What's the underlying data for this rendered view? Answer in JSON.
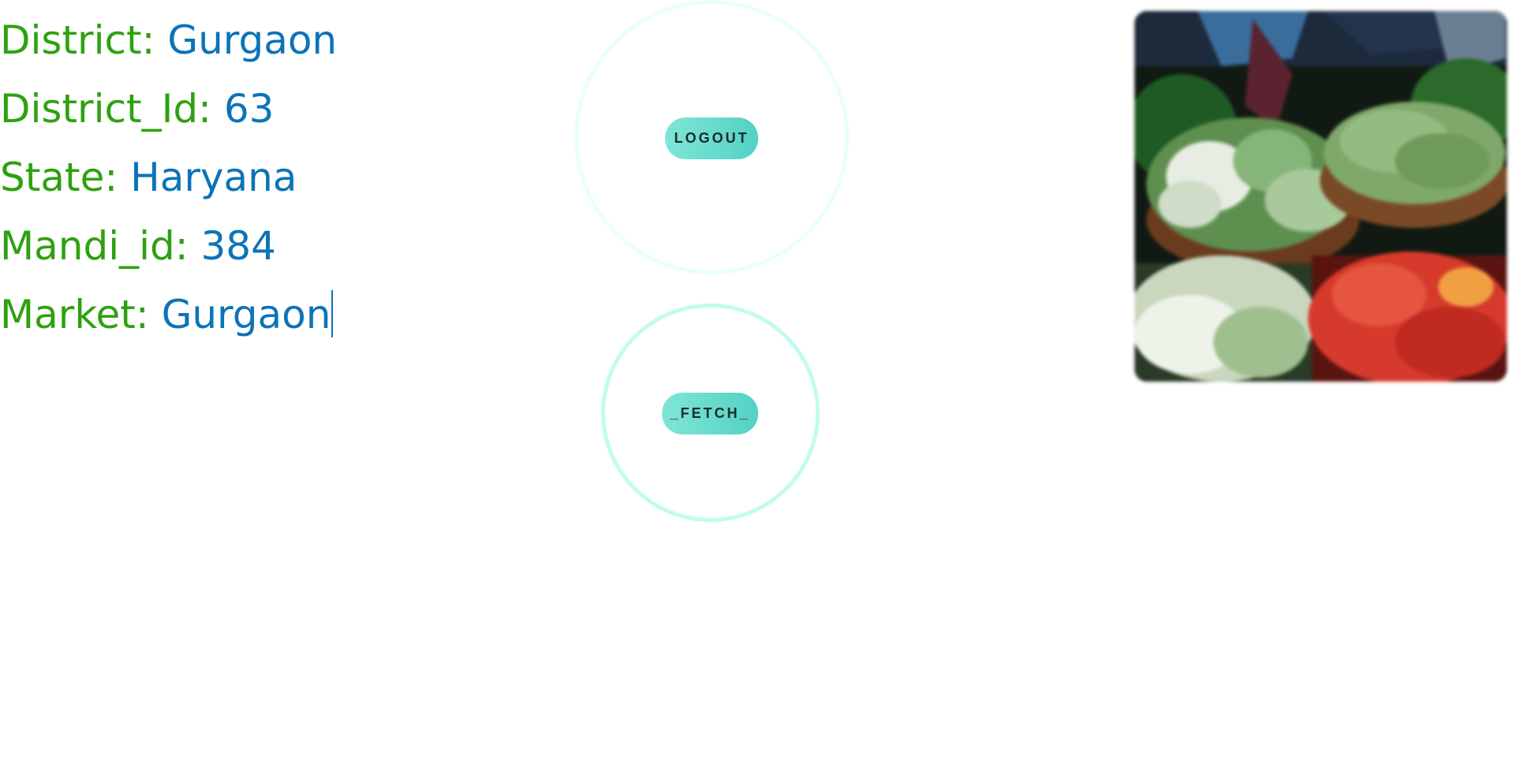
{
  "details": {
    "district_label": "District: ",
    "district_value": "Gurgaon",
    "district_id_label": "District_Id: ",
    "district_id_value": "63",
    "state_label": "State: ",
    "state_value": "Haryana",
    "mandi_id_label": "Mandi_id: ",
    "mandi_id_value": "384",
    "market_label": "Market: ",
    "market_value": "Gurgaon"
  },
  "buttons": {
    "logout_label": "LOGOUT",
    "fetch_label": "_FETCH_"
  },
  "image": {
    "subject": "vegetable market baskets",
    "alt": "Baskets of vegetables at a mandi"
  },
  "colors": {
    "label": "#2ea10f",
    "value": "#0c73b8",
    "button_accent": "#52d1c4",
    "fetch_ring": "#c2fbf0",
    "logout_ring": "#eafff9"
  }
}
